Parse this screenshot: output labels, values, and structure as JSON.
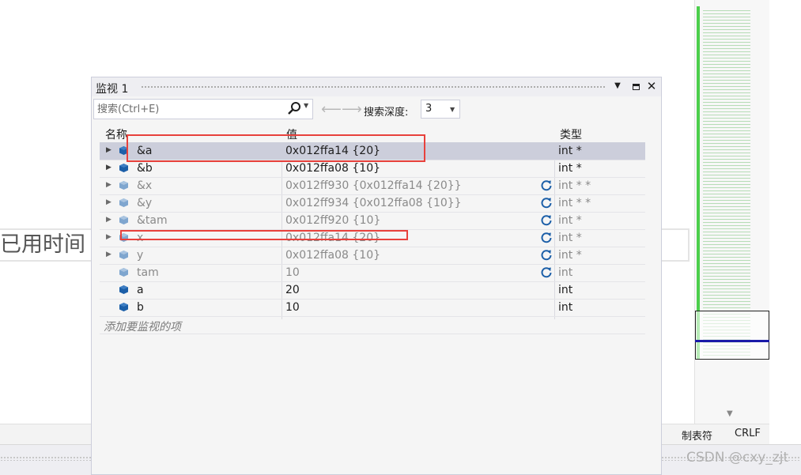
{
  "background": {
    "elapsed_label": "已用时间"
  },
  "watch": {
    "title": "监视 1",
    "search_placeholder": "搜索(Ctrl+E)",
    "depth_label": "搜索深度:",
    "depth_value": "3",
    "columns": {
      "name": "名称",
      "value": "值",
      "type": "类型"
    },
    "rows": [
      {
        "name": "&a",
        "value": "0x012ffa14 {20}",
        "type": "int *",
        "expandable": true,
        "dim": false,
        "refresh": false,
        "selected": true
      },
      {
        "name": "&b",
        "value": "0x012ffa08 {10}",
        "type": "int *",
        "expandable": true,
        "dim": false,
        "refresh": false,
        "selected": false
      },
      {
        "name": "&x",
        "value": "0x012ff930 {0x012ffa14 {20}}",
        "type": "int * *",
        "expandable": true,
        "dim": true,
        "refresh": true,
        "selected": false
      },
      {
        "name": "&y",
        "value": "0x012ff934 {0x012ffa08 {10}}",
        "type": "int * *",
        "expandable": true,
        "dim": true,
        "refresh": true,
        "selected": false
      },
      {
        "name": "&tam",
        "value": "0x012ff920 {10}",
        "type": "int *",
        "expandable": true,
        "dim": true,
        "refresh": true,
        "selected": false
      },
      {
        "name": "x",
        "value": "0x012ffa14 {20}",
        "type": "int *",
        "expandable": true,
        "dim": true,
        "refresh": true,
        "selected": false
      },
      {
        "name": "y",
        "value": "0x012ffa08 {10}",
        "type": "int *",
        "expandable": true,
        "dim": true,
        "refresh": true,
        "selected": false
      },
      {
        "name": "tam",
        "value": "10",
        "type": "int",
        "expandable": false,
        "dim": true,
        "refresh": true,
        "selected": false
      },
      {
        "name": "a",
        "value": "20",
        "type": "int",
        "expandable": false,
        "dim": false,
        "refresh": false,
        "selected": false
      },
      {
        "name": "b",
        "value": "10",
        "type": "int",
        "expandable": false,
        "dim": false,
        "refresh": false,
        "selected": false
      }
    ],
    "add_item_text": "添加要监视的项"
  },
  "status_bar": {
    "tab_mode": "制表符",
    "line_ending": "CRLF"
  },
  "watermark": "CSDN @cxy_zjt",
  "colors": {
    "accent_blue": "#1c5fa8",
    "annotation_red": "#e8413c",
    "selected_row": "#cccedb"
  }
}
